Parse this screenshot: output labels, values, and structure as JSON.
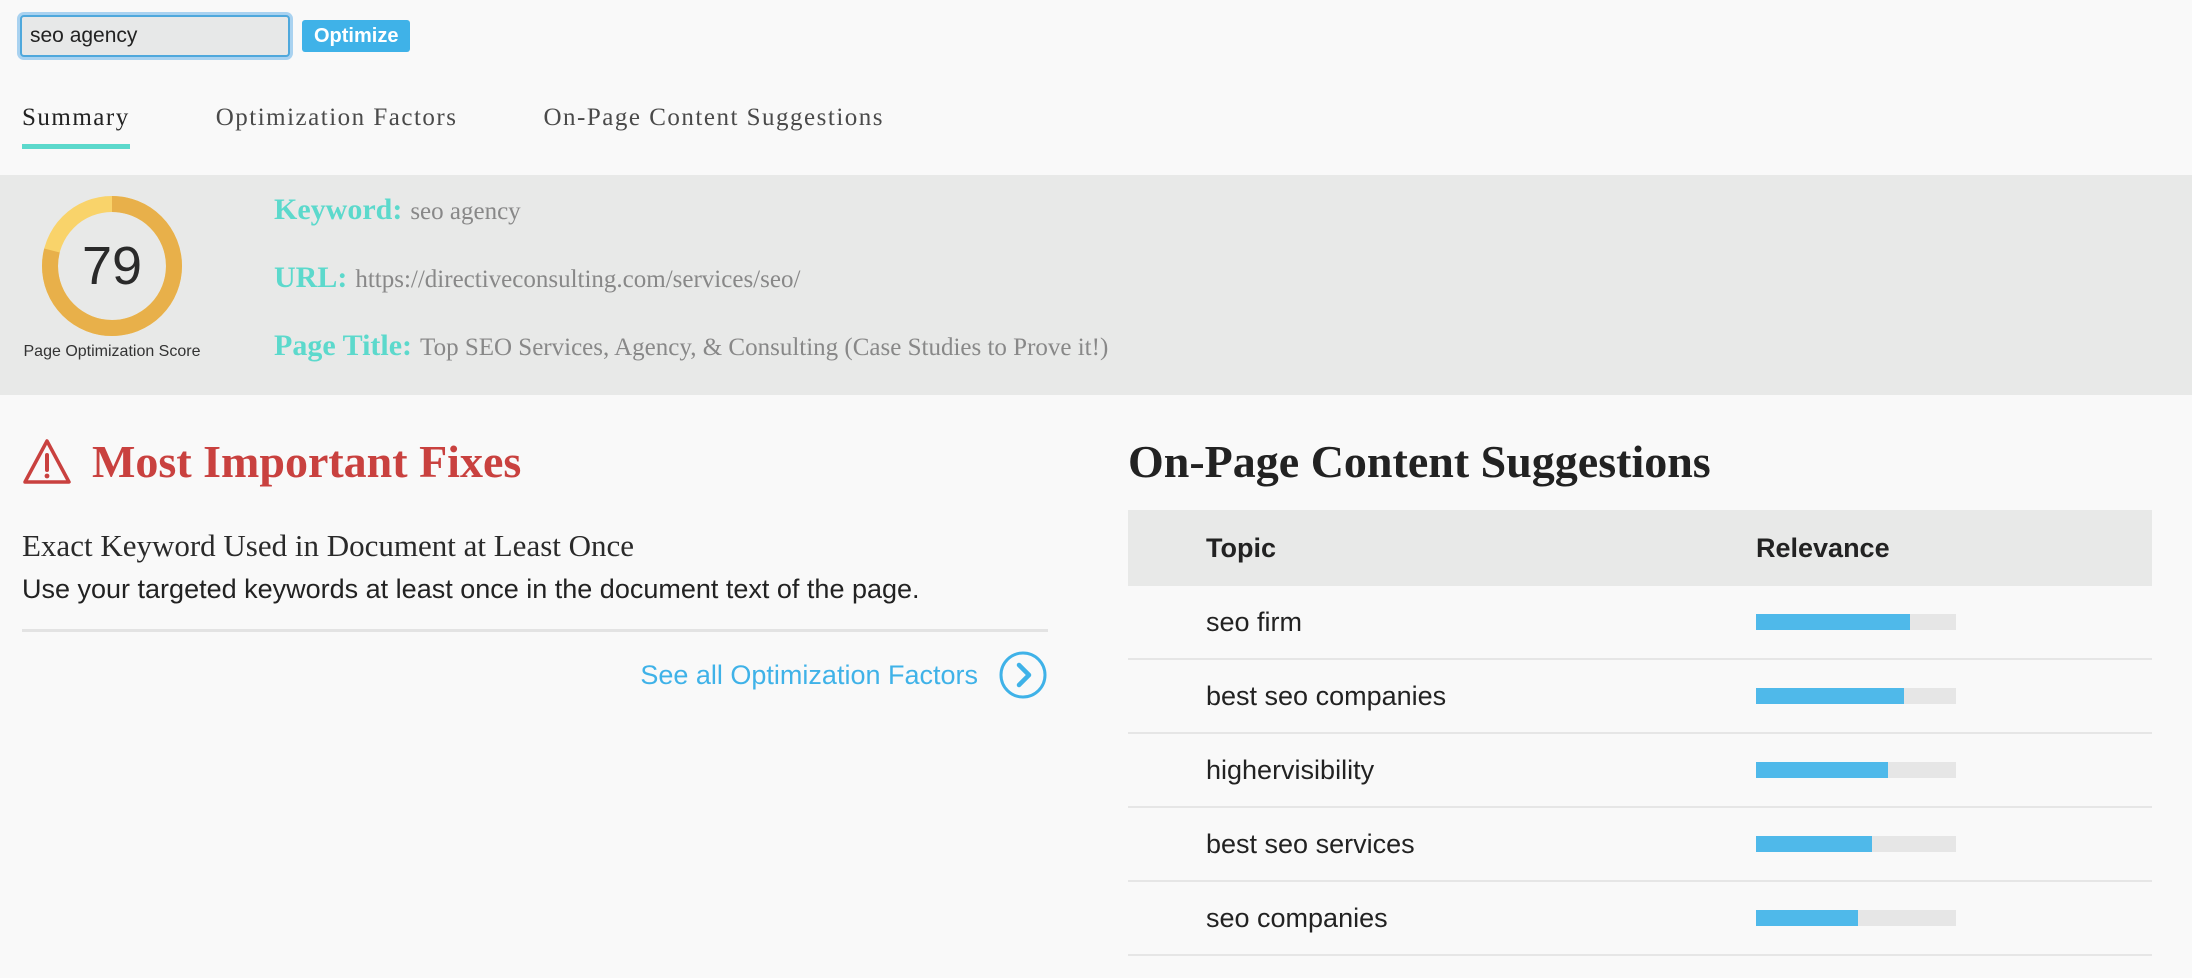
{
  "search": {
    "value": "seo agency",
    "button_label": "Optimize"
  },
  "tabs": [
    {
      "label": "Summary",
      "active": true
    },
    {
      "label": "Optimization Factors",
      "active": false
    },
    {
      "label": "On-Page Content Suggestions",
      "active": false
    }
  ],
  "score": {
    "value": "79",
    "label": "Page Optimization Score",
    "fraction": 0.79
  },
  "meta": {
    "keyword_label": "Keyword:",
    "keyword": "seo agency",
    "url_label": "URL:",
    "url": "https://directiveconsulting.com/services/seo/",
    "title_label": "Page Title:",
    "title": "Top SEO Services, Agency, & Consulting (Case Studies to Prove it!)"
  },
  "fixes": {
    "heading": "Most Important Fixes",
    "item_title": "Exact Keyword Used in Document at Least Once",
    "item_desc": "Use your targeted keywords at least once in the document text of the page.",
    "see_all": "See all Optimization Factors"
  },
  "suggestions": {
    "heading": "On-Page Content Suggestions",
    "col_topic": "Topic",
    "col_relevance": "Relevance",
    "rows": [
      {
        "topic": "seo firm",
        "relevance": 0.77
      },
      {
        "topic": "best seo companies",
        "relevance": 0.74
      },
      {
        "topic": "highervisibility",
        "relevance": 0.66
      },
      {
        "topic": "best seo services",
        "relevance": 0.58
      },
      {
        "topic": "seo companies",
        "relevance": 0.51
      }
    ]
  },
  "colors": {
    "accent": "#5cd9cc",
    "link": "#3fb2e8",
    "warning": "#c9413f",
    "score_ring": "#e8b04a",
    "score_ring_light": "#f9d36a",
    "bar": "#4fb9ea"
  }
}
